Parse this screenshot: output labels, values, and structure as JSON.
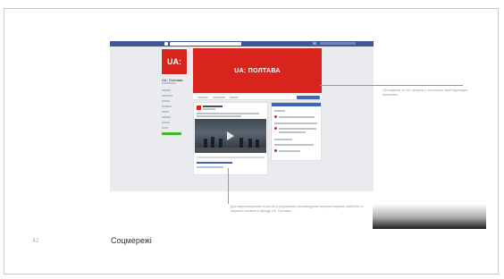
{
  "facebook_screenshot": {
    "logo_text": "UA:",
    "cover_title": "UA: ПОЛТАВА",
    "page_name": "UA: Полтава"
  },
  "callouts": {
    "right_note": "Обкладинка та UA: профіль з логотипом, який відповідає правилам...",
    "bottom_note": "Для відеоматеріалів та постів у соцмережах рекомендуємо використовувати шаблони та візуальні елементи бренду UA: Полтава..."
  },
  "footer": {
    "page_number": "42",
    "section_title": "Соцмережі"
  },
  "colors": {
    "brand_red": "#d8241d",
    "facebook_blue": "#3b5998"
  }
}
